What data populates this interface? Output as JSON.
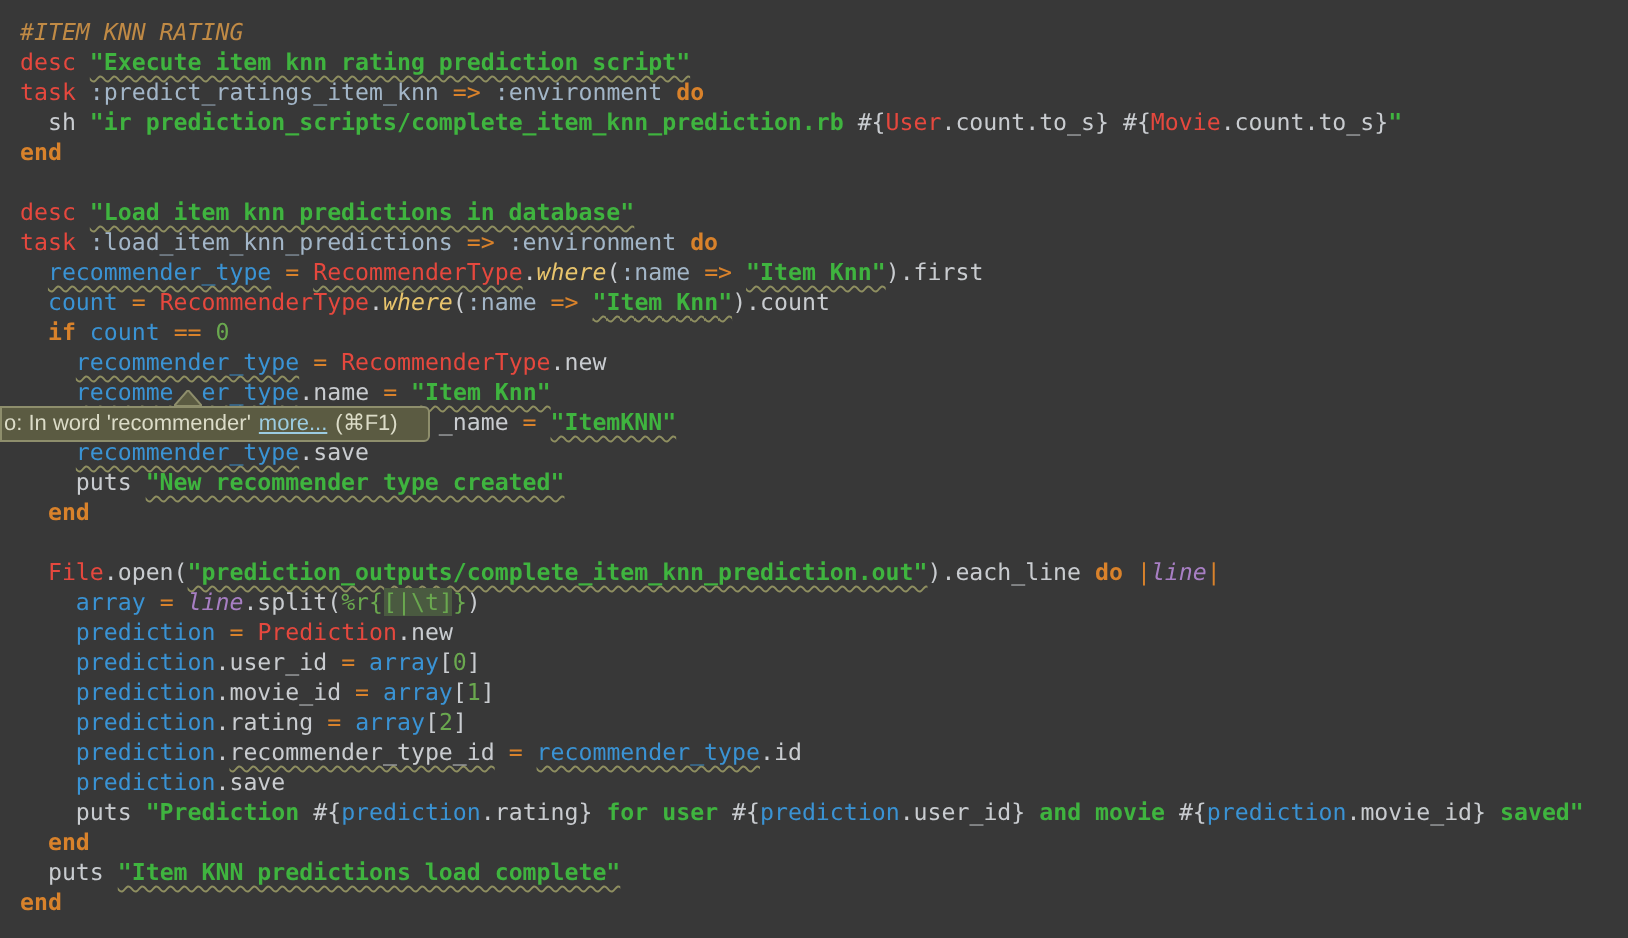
{
  "editor": {
    "blocks": [
      [
        {
          "tokens": [
            {
              "t": "#ITEM KNN RATING",
              "kind": "comment"
            }
          ]
        },
        {
          "tokens": [
            {
              "t": "desc ",
              "kind": "decl"
            },
            {
              "t": "\"Execute item knn rating prediction script\"",
              "kind": "str-flagged"
            }
          ]
        },
        {
          "tokens": [
            {
              "t": "task ",
              "kind": "decl"
            },
            {
              "t": ":predict_ratings_item_knn ",
              "kind": "sym"
            },
            {
              "t": "=> ",
              "kind": "op"
            },
            {
              "t": ":environment ",
              "kind": "sym"
            },
            {
              "t": "do",
              "kind": "kw"
            }
          ]
        },
        {
          "tokens": [
            {
              "t": "  sh ",
              "kind": "plain"
            },
            {
              "t": "\"ir prediction_scripts/complete_item_knn_prediction.rb ",
              "kind": "str"
            },
            {
              "t": "#{",
              "kind": "plain"
            },
            {
              "t": "User",
              "kind": "const"
            },
            {
              "t": ".count.to_s} #{",
              "kind": "plain"
            },
            {
              "t": "Movie",
              "kind": "const"
            },
            {
              "t": ".count.to_s}",
              "kind": "plain"
            },
            {
              "t": "\"",
              "kind": "str"
            }
          ]
        },
        {
          "tokens": [
            {
              "t": "end",
              "kind": "kw"
            }
          ]
        }
      ],
      [
        {
          "tokens": [
            {
              "t": "desc ",
              "kind": "decl"
            },
            {
              "t": "\"Load item knn predictions in database\"",
              "kind": "str-flagged"
            }
          ]
        },
        {
          "tokens": [
            {
              "t": "task ",
              "kind": "decl"
            },
            {
              "t": ":load_item_knn_predictions ",
              "kind": "sym"
            },
            {
              "t": "=> ",
              "kind": "op"
            },
            {
              "t": ":environment ",
              "kind": "sym"
            },
            {
              "t": "do",
              "kind": "kw"
            }
          ]
        },
        {
          "tokens": [
            {
              "t": "  recommender_type ",
              "kind": "var-flagged"
            },
            {
              "t": "= ",
              "kind": "op"
            },
            {
              "t": "RecommenderType",
              "kind": "const-flagged"
            },
            {
              "t": ".",
              "kind": "plain"
            },
            {
              "t": "where",
              "kind": "method"
            },
            {
              "t": "(",
              "kind": "plain"
            },
            {
              "t": ":name ",
              "kind": "sym"
            },
            {
              "t": "=> ",
              "kind": "op"
            },
            {
              "t": "\"Item Knn\"",
              "kind": "str-flagged"
            },
            {
              "t": ").first",
              "kind": "plain"
            }
          ]
        },
        {
          "tokens": [
            {
              "t": "  count ",
              "kind": "var"
            },
            {
              "t": "= ",
              "kind": "op"
            },
            {
              "t": "RecommenderType",
              "kind": "const"
            },
            {
              "t": ".",
              "kind": "plain"
            },
            {
              "t": "where",
              "kind": "method"
            },
            {
              "t": "(",
              "kind": "plain"
            },
            {
              "t": ":name ",
              "kind": "sym"
            },
            {
              "t": "=> ",
              "kind": "op"
            },
            {
              "t": "\"Item Knn\"",
              "kind": "str-flagged"
            },
            {
              "t": ").count",
              "kind": "plain"
            }
          ]
        },
        {
          "tokens": [
            {
              "t": "  if ",
              "kind": "kw"
            },
            {
              "t": "count ",
              "kind": "var"
            },
            {
              "t": "== ",
              "kind": "op"
            },
            {
              "t": "0",
              "kind": "num"
            }
          ]
        },
        {
          "tokens": [
            {
              "t": "    recommender_type ",
              "kind": "var-flagged"
            },
            {
              "t": "= ",
              "kind": "op"
            },
            {
              "t": "RecommenderType",
              "kind": "const"
            },
            {
              "t": ".new",
              "kind": "plain"
            }
          ]
        },
        {
          "tokens": [
            {
              "t": "    recomme",
              "kind": "var-flagged"
            },
            {
              "kind": "gap"
            },
            {
              "t": "er_type",
              "kind": "var-flagged"
            },
            {
              "t": ".name ",
              "kind": "plain"
            },
            {
              "t": "= ",
              "kind": "op"
            },
            {
              "t": "\"Item Knn\"",
              "kind": "str-flagged"
            }
          ]
        },
        {
          "tokens": [
            {
              "t": "                              _name ",
              "kind": "plain"
            },
            {
              "t": "= ",
              "kind": "op"
            },
            {
              "t": "\"ItemKNN\"",
              "kind": "str-flagged"
            }
          ]
        },
        {
          "tokens": [
            {
              "t": "    recommender_type",
              "kind": "var-flagged"
            },
            {
              "t": ".save",
              "kind": "plain"
            }
          ]
        },
        {
          "tokens": [
            {
              "t": "    puts ",
              "kind": "plain"
            },
            {
              "t": "\"New recommender type created\"",
              "kind": "str-flagged"
            }
          ]
        },
        {
          "tokens": [
            {
              "t": "  end",
              "kind": "kw"
            }
          ]
        }
      ],
      [
        {
          "tokens": [
            {
              "t": "  File",
              "kind": "const"
            },
            {
              "t": ".open(",
              "kind": "plain"
            },
            {
              "t": "\"prediction_outputs/complete_item_knn_prediction.out\"",
              "kind": "str-flagged"
            },
            {
              "t": ").each_line ",
              "kind": "plain"
            },
            {
              "t": "do ",
              "kind": "kw"
            },
            {
              "t": "|",
              "kind": "op"
            },
            {
              "t": "line",
              "kind": "param"
            },
            {
              "t": "|",
              "kind": "op"
            }
          ]
        },
        {
          "tokens": [
            {
              "t": "    array ",
              "kind": "var"
            },
            {
              "t": "= ",
              "kind": "op"
            },
            {
              "t": "line",
              "kind": "param"
            },
            {
              "t": ".split(",
              "kind": "plain"
            },
            {
              "t": "%r{",
              "kind": "num"
            },
            {
              "t": "[|\\t]",
              "kind": "regex"
            },
            {
              "t": "}",
              "kind": "num"
            },
            {
              "t": ")",
              "kind": "plain"
            }
          ]
        },
        {
          "tokens": [
            {
              "t": "    prediction ",
              "kind": "var"
            },
            {
              "t": "= ",
              "kind": "op"
            },
            {
              "t": "Prediction",
              "kind": "const"
            },
            {
              "t": ".new",
              "kind": "plain"
            }
          ]
        },
        {
          "tokens": [
            {
              "t": "    prediction",
              "kind": "var"
            },
            {
              "t": ".user_id ",
              "kind": "plain"
            },
            {
              "t": "= ",
              "kind": "op"
            },
            {
              "t": "array",
              "kind": "var"
            },
            {
              "t": "[",
              "kind": "plain"
            },
            {
              "t": "0",
              "kind": "num"
            },
            {
              "t": "]",
              "kind": "plain"
            }
          ]
        },
        {
          "tokens": [
            {
              "t": "    prediction",
              "kind": "var"
            },
            {
              "t": ".movie_id ",
              "kind": "plain"
            },
            {
              "t": "= ",
              "kind": "op"
            },
            {
              "t": "array",
              "kind": "var"
            },
            {
              "t": "[",
              "kind": "plain"
            },
            {
              "t": "1",
              "kind": "num"
            },
            {
              "t": "]",
              "kind": "plain"
            }
          ]
        },
        {
          "tokens": [
            {
              "t": "    prediction",
              "kind": "var"
            },
            {
              "t": ".rating ",
              "kind": "plain"
            },
            {
              "t": "= ",
              "kind": "op"
            },
            {
              "t": "array",
              "kind": "var"
            },
            {
              "t": "[",
              "kind": "plain"
            },
            {
              "t": "2",
              "kind": "num"
            },
            {
              "t": "]",
              "kind": "plain"
            }
          ]
        },
        {
          "tokens": [
            {
              "t": "    prediction",
              "kind": "var"
            },
            {
              "t": ".",
              "kind": "plain"
            },
            {
              "t": "recommender_type_id ",
              "kind": "plain-flagged"
            },
            {
              "t": "= ",
              "kind": "op"
            },
            {
              "t": "recommender_type",
              "kind": "var-flagged"
            },
            {
              "t": ".id",
              "kind": "plain"
            }
          ]
        },
        {
          "tokens": [
            {
              "t": "    prediction",
              "kind": "var"
            },
            {
              "t": ".save",
              "kind": "plain"
            }
          ]
        },
        {
          "tokens": [
            {
              "t": "    puts ",
              "kind": "plain"
            },
            {
              "t": "\"Prediction ",
              "kind": "str"
            },
            {
              "t": "#{",
              "kind": "plain"
            },
            {
              "t": "prediction",
              "kind": "var"
            },
            {
              "t": ".rating} ",
              "kind": "plain"
            },
            {
              "t": "for user ",
              "kind": "str"
            },
            {
              "t": "#{",
              "kind": "plain"
            },
            {
              "t": "prediction",
              "kind": "var"
            },
            {
              "t": ".user_id} ",
              "kind": "plain"
            },
            {
              "t": "and movie ",
              "kind": "str"
            },
            {
              "t": "#{",
              "kind": "plain"
            },
            {
              "t": "prediction",
              "kind": "var"
            },
            {
              "t": ".movie_id} ",
              "kind": "plain"
            },
            {
              "t": "saved\"",
              "kind": "str"
            }
          ]
        },
        {
          "tokens": [
            {
              "t": "  end",
              "kind": "kw"
            }
          ]
        },
        {
          "tokens": [
            {
              "t": "  puts ",
              "kind": "plain"
            },
            {
              "t": "\"Item KNN predictions load complete\"",
              "kind": "str-flagged"
            }
          ]
        },
        {
          "tokens": [
            {
              "t": "end",
              "kind": "kw"
            }
          ]
        }
      ]
    ]
  },
  "tooltip": {
    "text": "o: In word 'recommender'",
    "link": "more...",
    "shortcut": "(⌘F1)"
  }
}
